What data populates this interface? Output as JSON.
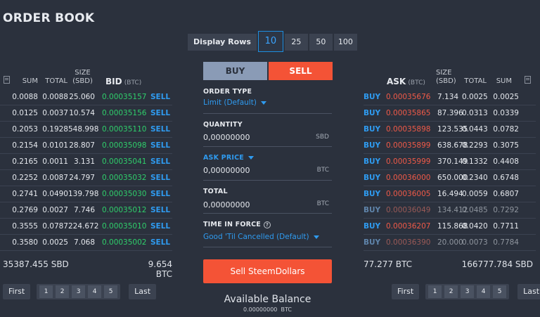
{
  "title": "ORDER BOOK",
  "display_rows": {
    "label": "Display Rows",
    "options": [
      "10",
      "25",
      "50",
      "100"
    ],
    "selected": "10"
  },
  "bids": {
    "headers": {
      "sum": "SUM",
      "total": "TOTAL",
      "size_top": "SIZE",
      "size_bottom": "(SBD)",
      "bid": "BID",
      "bid_unit": "(BTC)"
    },
    "rows": [
      {
        "sum": "0.0088",
        "total": "0.0088",
        "size": "25.060",
        "price": "0.00035157",
        "action": "SELL"
      },
      {
        "sum": "0.0125",
        "total": "0.0037",
        "size": "10.574",
        "price": "0.00035156",
        "action": "SELL"
      },
      {
        "sum": "0.2053",
        "total": "0.1928",
        "size": "548.998",
        "price": "0.00035110",
        "action": "SELL"
      },
      {
        "sum": "0.2154",
        "total": "0.0101",
        "size": "28.807",
        "price": "0.00035098",
        "action": "SELL"
      },
      {
        "sum": "0.2165",
        "total": "0.0011",
        "size": "3.131",
        "price": "0.00035041",
        "action": "SELL"
      },
      {
        "sum": "0.2252",
        "total": "0.0087",
        "size": "24.797",
        "price": "0.00035032",
        "action": "SELL"
      },
      {
        "sum": "0.2741",
        "total": "0.0490",
        "size": "139.798",
        "price": "0.00035030",
        "action": "SELL"
      },
      {
        "sum": "0.2769",
        "total": "0.0027",
        "size": "7.746",
        "price": "0.00035012",
        "action": "SELL"
      },
      {
        "sum": "0.3555",
        "total": "0.0787",
        "size": "224.672",
        "price": "0.00035010",
        "action": "SELL"
      },
      {
        "sum": "0.3580",
        "total": "0.0025",
        "size": "7.068",
        "price": "0.00035002",
        "action": "SELL"
      }
    ],
    "total_sbd": "35387.455 SBD",
    "total_btc": "9.654 BTC"
  },
  "asks": {
    "headers": {
      "ask": "ASK",
      "ask_unit": "(BTC)",
      "size_top": "SIZE",
      "size_bottom": "(SBD)",
      "total": "TOTAL",
      "sum": "SUM"
    },
    "rows": [
      {
        "action": "BUY",
        "price": "0.00035676",
        "size": "7.134",
        "total": "0.0025",
        "sum": "0.0025",
        "dim": false
      },
      {
        "action": "BUY",
        "price": "0.00035865",
        "size": "87.396",
        "total": "0.0313",
        "sum": "0.0339",
        "dim": false
      },
      {
        "action": "BUY",
        "price": "0.00035898",
        "size": "123.535",
        "total": "0.0443",
        "sum": "0.0782",
        "dim": false
      },
      {
        "action": "BUY",
        "price": "0.00035899",
        "size": "638.678",
        "total": "0.2293",
        "sum": "0.3075",
        "dim": false
      },
      {
        "action": "BUY",
        "price": "0.00035999",
        "size": "370.149",
        "total": "0.1332",
        "sum": "0.4408",
        "dim": false
      },
      {
        "action": "BUY",
        "price": "0.00036000",
        "size": "650.000",
        "total": "0.2340",
        "sum": "0.6748",
        "dim": false
      },
      {
        "action": "BUY",
        "price": "0.00036005",
        "size": "16.494",
        "total": "0.0059",
        "sum": "0.6807",
        "dim": false
      },
      {
        "action": "BUY",
        "price": "0.00036049",
        "size": "134.412",
        "total": "0.0485",
        "sum": "0.7292",
        "dim": true
      },
      {
        "action": "BUY",
        "price": "0.00036207",
        "size": "115.868",
        "total": "0.0420",
        "sum": "0.7711",
        "dim": false
      },
      {
        "action": "BUY",
        "price": "0.00036390",
        "size": "20.000",
        "total": "0.0073",
        "sum": "0.7784",
        "dim": true
      }
    ],
    "total_btc": "77.277 BTC",
    "total_sbd": "166777.784 SBD"
  },
  "pagination": {
    "first": "First",
    "last": "Last",
    "pages": [
      "1",
      "2",
      "3",
      "4",
      "5"
    ]
  },
  "form": {
    "buy_tab": "BUY",
    "sell_tab": "SELL",
    "order_type_label": "ORDER TYPE",
    "order_type_value": "Limit (Default)",
    "quantity_label": "QUANTITY",
    "quantity_value": "0,00000000",
    "quantity_unit": "SBD",
    "ask_price_label": "ASK PRICE",
    "ask_price_value": "0,00000000",
    "ask_price_unit": "BTC",
    "total_label": "TOTAL",
    "total_value": "0,00000000",
    "total_unit": "BTC",
    "tif_label": "TIME IN FORCE",
    "tif_value": "Good 'Til Cancelled (Default)",
    "submit_label": "Sell SteemDollars",
    "available_title": "Available Balance",
    "available_value": "0.00000000  BTC"
  },
  "colors": {
    "bg": "#2b313d",
    "green": "#2fce6b",
    "red": "#f05a48",
    "blue": "#2f9bf0",
    "sell_orange": "#f45336"
  }
}
